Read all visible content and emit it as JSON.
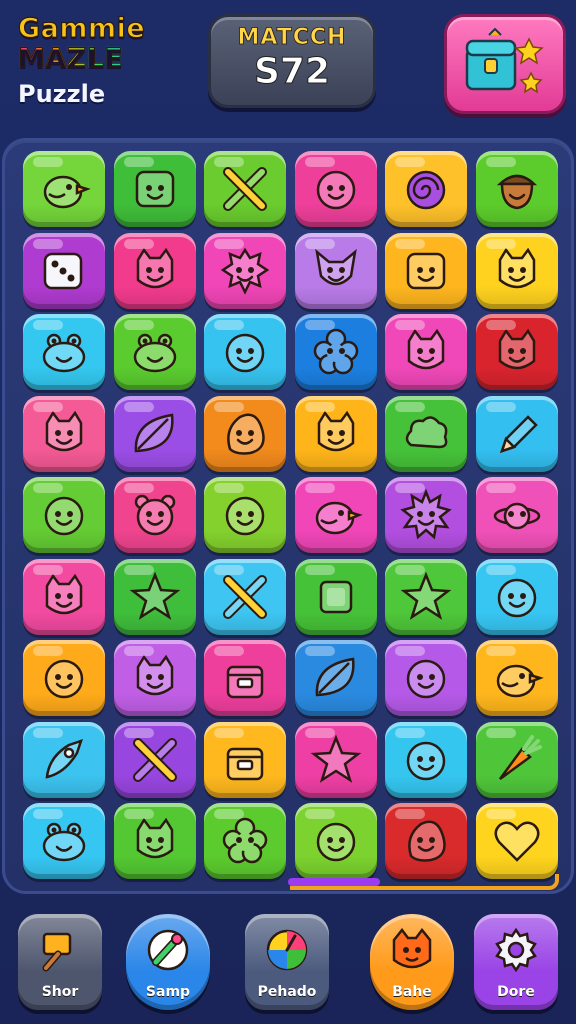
{
  "header": {
    "logo_line1": "Gammie",
    "logo_line2": "MAZLE",
    "logo_sub": "Puzzle",
    "score_title": "MATCCH",
    "score_value": "S72",
    "chest_icon": "treasure-chest-icon"
  },
  "board": {
    "rows": 9,
    "cols": 6,
    "tiles": [
      [
        {
          "color": "#74d63a",
          "icon": "bird"
        },
        {
          "color": "#3fbe3a",
          "icon": "square-face"
        },
        {
          "color": "#6acc2e",
          "icon": "crossed-tools"
        },
        {
          "color": "#ee3f9a",
          "icon": "face"
        },
        {
          "color": "#ffc12a",
          "icon": "spiral-creature"
        },
        {
          "color": "#5ccc2c",
          "icon": "acorn"
        }
      ],
      [
        {
          "color": "#b03bd0",
          "icon": "dice"
        },
        {
          "color": "#f23b8d",
          "icon": "cat-face"
        },
        {
          "color": "#f046b7",
          "icon": "spiky-face"
        },
        {
          "color": "#b87be8",
          "icon": "fox-face"
        },
        {
          "color": "#ffb61e",
          "icon": "square-face"
        },
        {
          "color": "#ffd21f",
          "icon": "cat-face"
        }
      ],
      [
        {
          "color": "#34c8f0",
          "icon": "frog"
        },
        {
          "color": "#5bcc2f",
          "icon": "frog"
        },
        {
          "color": "#36c3f0",
          "icon": "face"
        },
        {
          "color": "#1c7fe0",
          "icon": "flower"
        },
        {
          "color": "#f048b8",
          "icon": "cat-face"
        },
        {
          "color": "#d9242e",
          "icon": "cat-face"
        }
      ],
      [
        {
          "color": "#f45a95",
          "icon": "cat-face"
        },
        {
          "color": "#9b4ee6",
          "icon": "leaf"
        },
        {
          "color": "#f28a1c",
          "icon": "blob"
        },
        {
          "color": "#ffb51a",
          "icon": "cat-face"
        },
        {
          "color": "#46c23a",
          "icon": "cloud"
        },
        {
          "color": "#33bff0",
          "icon": "pencil"
        }
      ],
      [
        {
          "color": "#64cc34",
          "icon": "face"
        },
        {
          "color": "#f0448f",
          "icon": "bear-face"
        },
        {
          "color": "#84d12e",
          "icon": "face"
        },
        {
          "color": "#f046b8",
          "icon": "bird"
        },
        {
          "color": "#b24fe0",
          "icon": "sun-face"
        },
        {
          "color": "#f051b8",
          "icon": "saturn"
        }
      ],
      [
        {
          "color": "#f24aa0",
          "icon": "cat-face"
        },
        {
          "color": "#3fbe3c",
          "icon": "star"
        },
        {
          "color": "#3ec5f2",
          "icon": "crossed-tools"
        },
        {
          "color": "#46c238",
          "icon": "square"
        },
        {
          "color": "#4fc73a",
          "icon": "star"
        },
        {
          "color": "#37c6f2",
          "icon": "face"
        }
      ],
      [
        {
          "color": "#ffaa1a",
          "icon": "face"
        },
        {
          "color": "#c05fe6",
          "icon": "cat-face"
        },
        {
          "color": "#ee3f9d",
          "icon": "box"
        },
        {
          "color": "#2a8ae0",
          "icon": "leaf"
        },
        {
          "color": "#b55ae8",
          "icon": "face"
        },
        {
          "color": "#ffb61d",
          "icon": "bird"
        }
      ],
      [
        {
          "color": "#3cc3f0",
          "icon": "rocket"
        },
        {
          "color": "#9846e0",
          "icon": "crossed-tools"
        },
        {
          "color": "#ffb81e",
          "icon": "box"
        },
        {
          "color": "#ee3fa4",
          "icon": "star"
        },
        {
          "color": "#35c6f0",
          "icon": "face"
        },
        {
          "color": "#4fc63a",
          "icon": "carrot"
        }
      ],
      [
        {
          "color": "#36c6f2",
          "icon": "frog"
        },
        {
          "color": "#53c832",
          "icon": "cat-face"
        },
        {
          "color": "#5ccb2e",
          "icon": "flower"
        },
        {
          "color": "#7cd22e",
          "icon": "face"
        },
        {
          "color": "#d92a2c",
          "icon": "blob"
        },
        {
          "color": "#ffd41e",
          "icon": "heart"
        }
      ]
    ]
  },
  "bottom_bar": [
    {
      "label": "Shor",
      "icon": "hammer-icon",
      "color": "#4e566e",
      "round": false
    },
    {
      "label": "Samp",
      "icon": "brush-icon",
      "color": "#2a86e8",
      "round": true
    },
    {
      "label": "Pehado",
      "icon": "color-wheel-icon",
      "color": "#4c5a7e",
      "round": false
    },
    {
      "label": "Bahe",
      "icon": "cat-icon",
      "color": "#ff9a1a",
      "round": true
    },
    {
      "label": "Dore",
      "icon": "gear-icon",
      "color": "#9a43e6",
      "round": false
    }
  ]
}
